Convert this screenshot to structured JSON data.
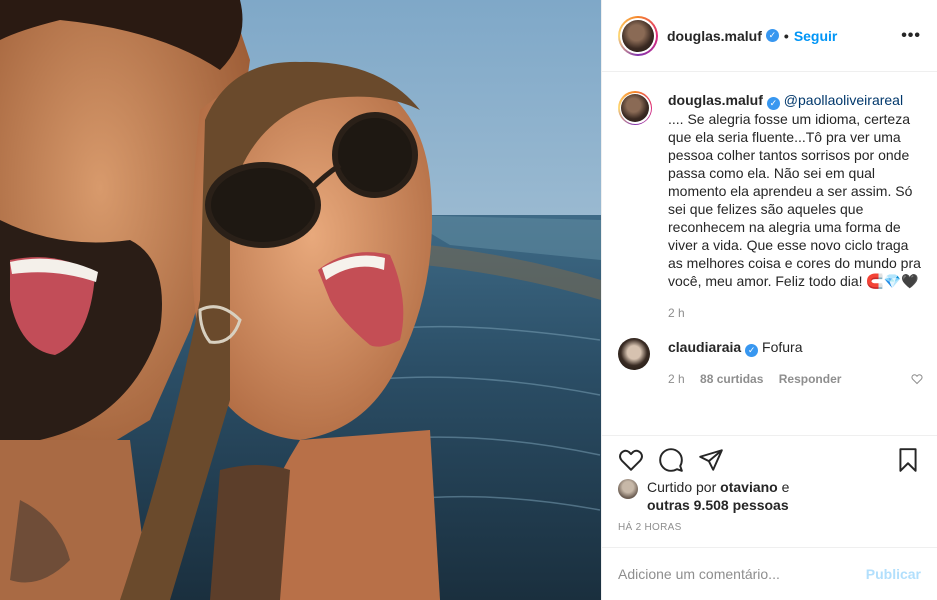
{
  "post": {
    "username": "douglas.maluf",
    "follow_label": "Seguir",
    "more_label": "•••",
    "dot": "•"
  },
  "caption": {
    "username": "douglas.maluf",
    "mention": "@paollaoliveirareal",
    "text": " .... Se alegria fosse um idioma, certeza que ela seria fluente...Tô pra ver uma pessoa colher tantos sorrisos por onde passa como ela. Não sei em qual momento ela aprendeu a ser assim. Só sei que felizes são aqueles que reconhecem na alegria uma forma de viver a vida. Que esse novo ciclo traga as melhores coisa e cores do mundo pra você, meu amor. Feliz todo dia! 🧲💎🖤",
    "time": "2 h"
  },
  "comment": {
    "username": "claudiaraia",
    "text": "Fofura",
    "time": "2 h",
    "likes": "88 curtidas",
    "reply": "Responder"
  },
  "likes": {
    "prefix": "Curtido por ",
    "user": "otaviano",
    "middle": " e ",
    "others": "outras 9.508 pessoas"
  },
  "timestamp": "HÁ 2 HORAS",
  "add_comment": {
    "placeholder": "Adicione um comentário...",
    "publish": "Publicar"
  },
  "icons": {
    "verified": "verified-badge-icon",
    "like": "heart-icon",
    "comment": "comment-icon",
    "share": "send-icon",
    "save": "bookmark-icon"
  },
  "colors": {
    "accent": "#0095f6",
    "verified": "#3897f0",
    "publish_disabled": "#b2dffc"
  }
}
